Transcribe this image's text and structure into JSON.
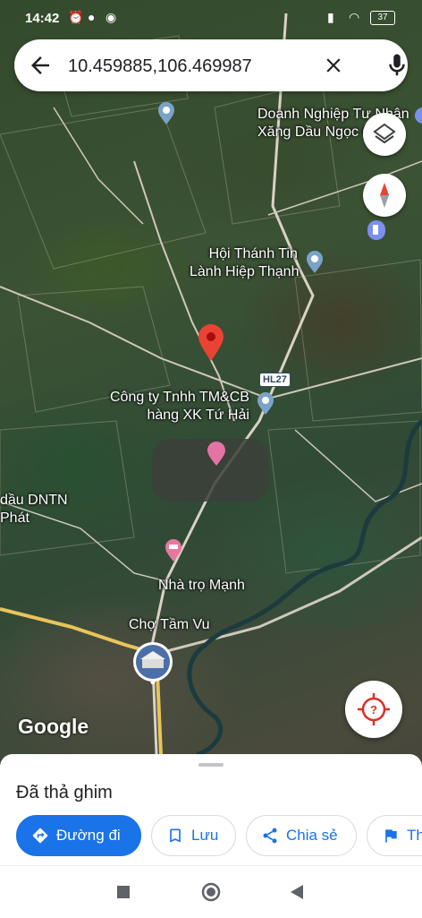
{
  "status_bar": {
    "time": "14:42",
    "battery": "37"
  },
  "search": {
    "query": "10.459885,106.469987"
  },
  "map": {
    "labels": {
      "gas_station_1": "Doanh Nghiệp Tư Nhân",
      "gas_station_2": "Xăng Dầu Ngọc Ch",
      "church_1": "Hội Thánh Tin",
      "church_2": "Lành Hiệp Thạnh",
      "company_1": "Công ty Tnhh TM&CB",
      "company_2": "hàng XK Tứ Hải",
      "left_1": "dầu DNTN",
      "left_2": "Phát",
      "motel": "Nhà trọ Mạnh",
      "market": "Chợ Tầm Vu"
    },
    "route_shield": "HL27",
    "logo": "Google",
    "colors": {
      "pin": "#ea4335",
      "pink_pin": "#e573a3",
      "road": "#e8c45a"
    }
  },
  "sheet": {
    "title": "Đã thả ghim",
    "chips": [
      {
        "label": "Đường đi",
        "icon": "directions-icon"
      },
      {
        "label": "Lưu",
        "icon": "bookmark-icon"
      },
      {
        "label": "Chia sẻ",
        "icon": "share-icon"
      },
      {
        "label": "Th",
        "icon": "flag-icon"
      }
    ]
  },
  "nav": {
    "icons": [
      "recents-square-icon",
      "home-circle-icon",
      "back-triangle-icon"
    ]
  }
}
